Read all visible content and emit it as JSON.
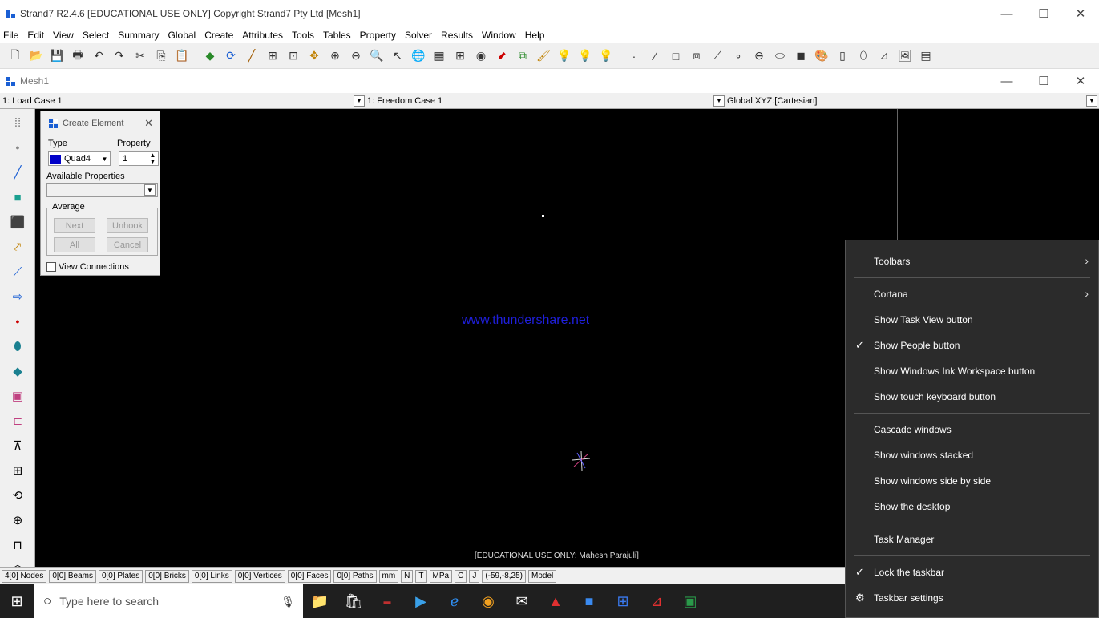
{
  "app": {
    "title": "Strand7 R2.4.6 [EDUCATIONAL USE ONLY] Copyright Strand7 Pty Ltd [Mesh1]",
    "window_controls": {
      "minimize": "—",
      "maximize": "☐",
      "close": "✕"
    }
  },
  "menu": [
    "File",
    "Edit",
    "View",
    "Select",
    "Summary",
    "Global",
    "Create",
    "Attributes",
    "Tools",
    "Tables",
    "Property",
    "Solver",
    "Results",
    "Window",
    "Help"
  ],
  "mdi": {
    "title": "Mesh1"
  },
  "cases": {
    "load_case": "1: Load Case 1",
    "freedom_case": "1: Freedom Case 1",
    "coord_system": "Global XYZ:[Cartesian]"
  },
  "create_element": {
    "title": "Create Element",
    "type_label": "Type",
    "property_label": "Property",
    "type_value": "Quad4",
    "property_value": "1",
    "available_properties_label": "Available Properties",
    "average_label": "Average",
    "buttons": {
      "next": "Next",
      "unhook": "Unhook",
      "all": "All",
      "cancel": "Cancel"
    },
    "view_connections_label": "View Connections",
    "type_color": "#0000c8"
  },
  "canvas": {
    "watermark": "www.thundershare.net",
    "edu_label": "[EDUCATIONAL USE ONLY: Mahesh Parajuli]"
  },
  "status": [
    "4[0] Nodes",
    "0[0] Beams",
    "0[0] Plates",
    "0[0] Bricks",
    "0[0] Links",
    "0[0] Vertices",
    "0[0] Faces",
    "0[0] Paths",
    "mm",
    "N",
    "T",
    "MPa",
    "C",
    "J",
    "(-59,-8,25)",
    "Model"
  ],
  "taskbar": {
    "search_placeholder": "Type here to search"
  },
  "context_menu": {
    "items": [
      {
        "label": "Toolbars",
        "submenu": true,
        "checked": false
      },
      {
        "label": "Cortana",
        "submenu": true,
        "checked": false
      },
      {
        "label": "Show Task View button",
        "submenu": false,
        "checked": false
      },
      {
        "label": "Show People button",
        "submenu": false,
        "checked": true
      },
      {
        "label": "Show Windows Ink Workspace button",
        "submenu": false,
        "checked": false
      },
      {
        "label": "Show touch keyboard button",
        "submenu": false,
        "checked": false
      },
      {
        "label": "Cascade windows",
        "submenu": false,
        "checked": false
      },
      {
        "label": "Show windows stacked",
        "submenu": false,
        "checked": false
      },
      {
        "label": "Show windows side by side",
        "submenu": false,
        "checked": false
      },
      {
        "label": "Show the desktop",
        "submenu": false,
        "checked": false
      },
      {
        "label": "Task Manager",
        "submenu": false,
        "checked": false
      },
      {
        "label": "Lock the taskbar",
        "submenu": false,
        "checked": true
      },
      {
        "label": "Taskbar settings",
        "submenu": false,
        "checked": false,
        "gear": true
      }
    ],
    "check_mark": "✓",
    "arrow": "›",
    "gear": "⚙"
  }
}
